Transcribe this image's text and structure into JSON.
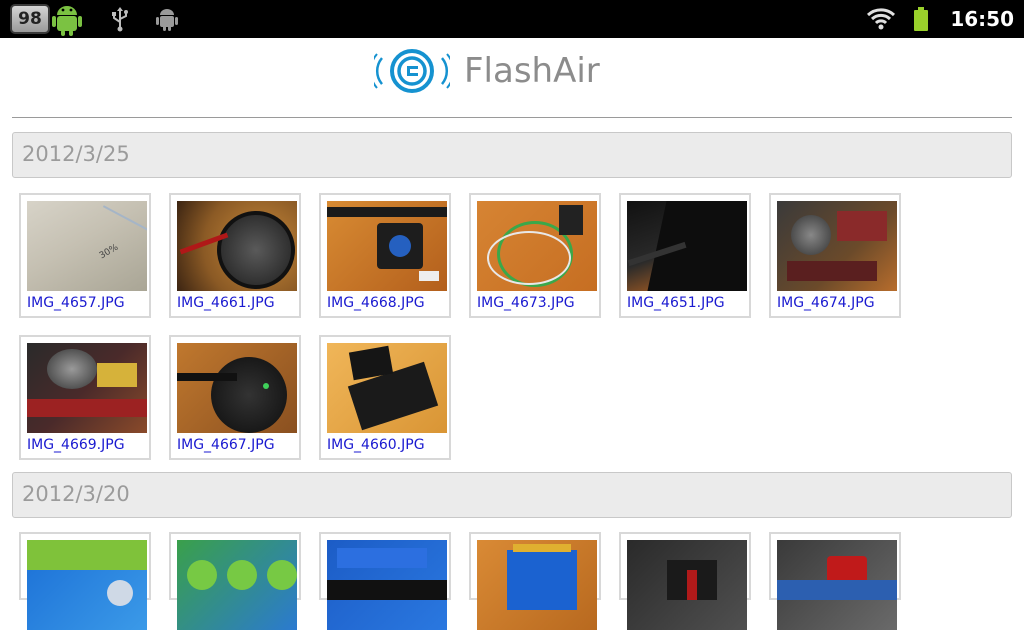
{
  "status_bar": {
    "battery_badge": "98",
    "time": "16:50"
  },
  "header": {
    "logo_text": "FlashAir"
  },
  "sections": [
    {
      "date": "2012/3/25",
      "files": [
        "IMG_4657.JPG",
        "IMG_4661.JPG",
        "IMG_4668.JPG",
        "IMG_4673.JPG",
        "IMG_4651.JPG",
        "IMG_4674.JPG",
        "IMG_4669.JPG",
        "IMG_4667.JPG",
        "IMG_4660.JPG"
      ]
    },
    {
      "date": "2012/3/20",
      "files": []
    }
  ],
  "colors": {
    "link": "#1a1ad0",
    "logo_blue": "#1592d0",
    "date_bar": "#ebebeb"
  }
}
